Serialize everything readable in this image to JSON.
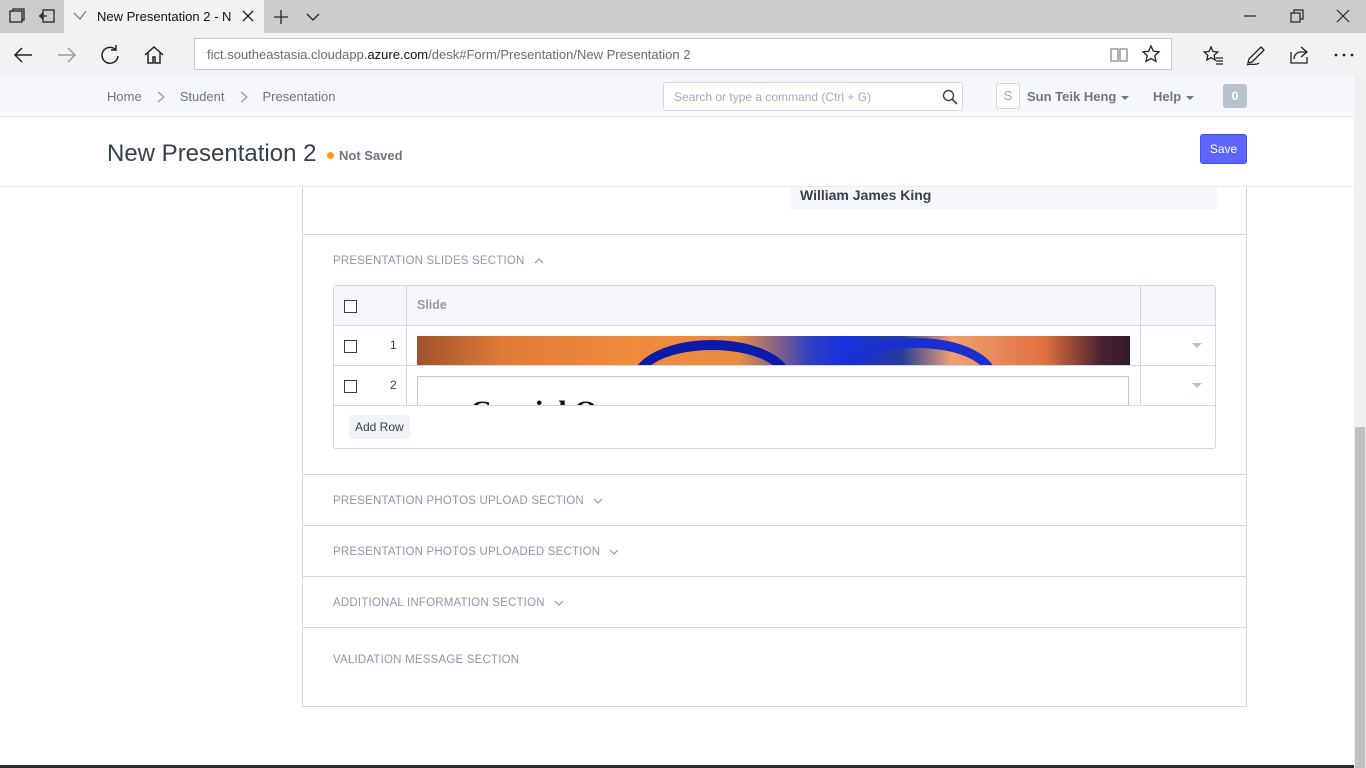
{
  "browser": {
    "tab_title": "New Presentation 2 - N",
    "url_prefix": "fict.southeastasia.cloudapp.",
    "url_domain": "azure.com",
    "url_suffix": "/desk#Form/Presentation/New Presentation 2"
  },
  "app_header": {
    "breadcrumbs": [
      "Home",
      "Student",
      "Presentation"
    ],
    "search_placeholder": "Search or type a command (Ctrl + G)",
    "avatar_letter": "S",
    "user_name": "Sun Teik Heng",
    "help_label": "Help",
    "notification_count": "0"
  },
  "page": {
    "title": "New Presentation 2",
    "status": "Not Saved",
    "save_label": "Save",
    "status_color": "#ffa00a",
    "primary_color": "#5e64ff"
  },
  "form": {
    "field_value": "William James King",
    "slides_section": {
      "heading": "PRESENTATION SLIDES SECTION",
      "column_header": "Slide",
      "rows": [
        {
          "idx": "1"
        },
        {
          "idx": "2",
          "slide_text": "Crucial Q"
        }
      ],
      "add_row_label": "Add Row"
    },
    "sections": [
      "PRESENTATION PHOTOS UPLOAD SECTION",
      "PRESENTATION PHOTOS UPLOADED SECTION",
      "ADDITIONAL INFORMATION SECTION",
      "VALIDATION MESSAGE SECTION"
    ]
  },
  "icons": {
    "tab_strip": [
      "tab-sets-icon",
      "tab-aside-icon",
      "new-tab-icon",
      "tab-list-icon"
    ],
    "navigation": [
      "back-icon",
      "forward-icon",
      "refresh-icon",
      "home-icon"
    ],
    "toolbar": [
      "reading-view-icon",
      "favorite-star-icon",
      "favorites-hub-icon",
      "pen-icon",
      "share-icon",
      "more-icon"
    ],
    "window": [
      "minimize-icon",
      "restore-icon",
      "close-window-icon"
    ]
  }
}
